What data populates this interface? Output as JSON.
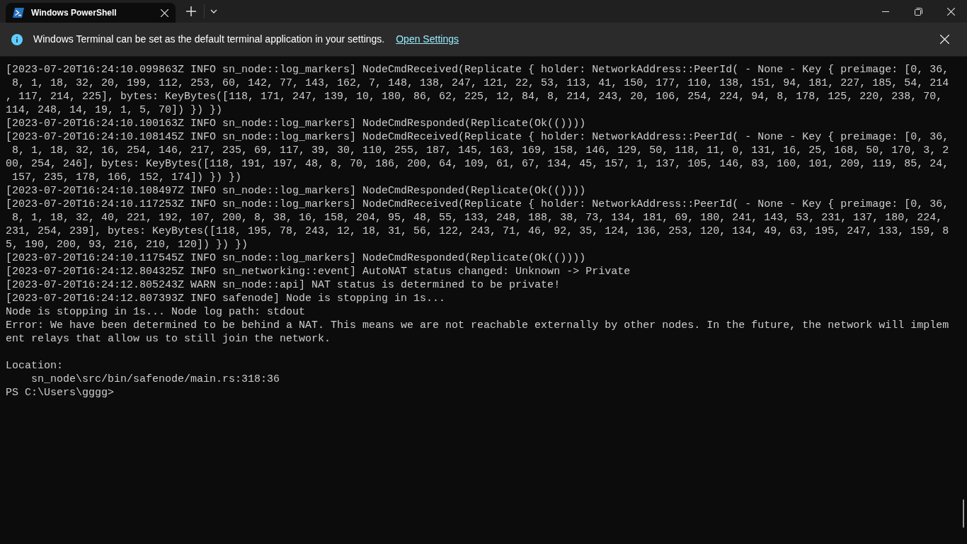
{
  "tabs": [
    {
      "title": "Windows PowerShell",
      "selected": true
    }
  ],
  "infobar": {
    "message": "Windows Terminal can be set as the default terminal application in your settings.",
    "link": "Open Settings"
  },
  "terminal": {
    "lines": [
      {
        "kind": "output",
        "text": "[2023-07-20T16:24:10.099863Z INFO sn_node::log_markers] NodeCmdReceived(Replicate { holder: NetworkAddress::PeerId( - None - Key { preimage: [0, 36,"
      },
      {
        "kind": "output",
        "text": " 8, 1, 18, 32, 20, 199, 112, 253, 60, 142, 77, 143, 162, 7, 148, 138, 247, 121, 22, 53, 113, 41, 150, 177, 110, 138, 151, 94, 181, 227, 185, 54, 214"
      },
      {
        "kind": "output",
        "text": ", 117, 214, 225], bytes: KeyBytes([118, 171, 247, 139, 10, 180, 86, 62, 225, 12, 84, 8, 214, 243, 20, 106, 254, 224, 94, 8, 178, 125, 220, 238, 70,"
      },
      {
        "kind": "output",
        "text": "114, 248, 14, 19, 1, 5, 70]) }) })"
      },
      {
        "kind": "output",
        "text": "[2023-07-20T16:24:10.100163Z INFO sn_node::log_markers] NodeCmdResponded(Replicate(Ok(())))"
      },
      {
        "kind": "output",
        "text": "[2023-07-20T16:24:10.108145Z INFO sn_node::log_markers] NodeCmdReceived(Replicate { holder: NetworkAddress::PeerId( - None - Key { preimage: [0, 36,"
      },
      {
        "kind": "output",
        "text": " 8, 1, 18, 32, 16, 254, 146, 217, 235, 69, 117, 39, 30, 110, 255, 187, 145, 163, 169, 158, 146, 129, 50, 118, 11, 0, 131, 16, 25, 168, 50, 170, 3, 2"
      },
      {
        "kind": "output",
        "text": "00, 254, 246], bytes: KeyBytes([118, 191, 197, 48, 8, 70, 186, 200, 64, 109, 61, 67, 134, 45, 157, 1, 137, 105, 146, 83, 160, 101, 209, 119, 85, 24,"
      },
      {
        "kind": "output",
        "text": " 157, 235, 178, 166, 152, 174]) }) })"
      },
      {
        "kind": "output",
        "text": "[2023-07-20T16:24:10.108497Z INFO sn_node::log_markers] NodeCmdResponded(Replicate(Ok(())))"
      },
      {
        "kind": "output",
        "text": "[2023-07-20T16:24:10.117253Z INFO sn_node::log_markers] NodeCmdReceived(Replicate { holder: NetworkAddress::PeerId( - None - Key { preimage: [0, 36,"
      },
      {
        "kind": "output",
        "text": " 8, 1, 18, 32, 40, 221, 192, 107, 200, 8, 38, 16, 158, 204, 95, 48, 55, 133, 248, 188, 38, 73, 134, 181, 69, 180, 241, 143, 53, 231, 137, 180, 224,"
      },
      {
        "kind": "output",
        "text": "231, 254, 239], bytes: KeyBytes([118, 195, 78, 243, 12, 18, 31, 56, 122, 243, 71, 46, 92, 35, 124, 136, 253, 120, 134, 49, 63, 195, 247, 133, 159, 8"
      },
      {
        "kind": "output",
        "text": "5, 190, 200, 93, 216, 210, 120]) }) })"
      },
      {
        "kind": "output",
        "text": "[2023-07-20T16:24:10.117545Z INFO sn_node::log_markers] NodeCmdResponded(Replicate(Ok(())))"
      },
      {
        "kind": "output",
        "text": "[2023-07-20T16:24:12.804325Z INFO sn_networking::event] AutoNAT status changed: Unknown -> Private"
      },
      {
        "kind": "output",
        "text": "[2023-07-20T16:24:12.805243Z WARN sn_node::api] NAT status is determined to be private!"
      },
      {
        "kind": "output",
        "text": "[2023-07-20T16:24:12.807393Z INFO safenode] Node is stopping in 1s..."
      },
      {
        "kind": "output",
        "text": "Node is stopping in 1s... Node log path: stdout"
      },
      {
        "kind": "output",
        "text": "Error: We have been determined to be behind a NAT. This means we are not reachable externally by other nodes. In the future, the network will implem"
      },
      {
        "kind": "output",
        "text": "ent relays that allow us to still join the network."
      },
      {
        "kind": "blank"
      },
      {
        "kind": "output",
        "text": "Location:"
      },
      {
        "kind": "output",
        "text": "    sn_node\\src/bin/safenode/main.rs:318:36"
      },
      {
        "kind": "prompt",
        "text": "PS C:\\Users\\gggg>"
      }
    ]
  }
}
